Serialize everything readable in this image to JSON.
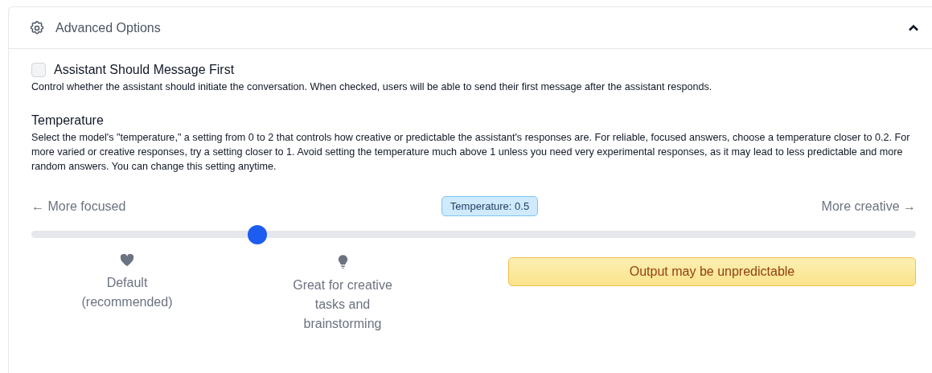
{
  "panel": {
    "title": "Advanced Options",
    "expanded": true
  },
  "assistant_first": {
    "label": "Assistant Should Message First",
    "checked": false,
    "description": "Control whether the assistant should initiate the conversation. When checked, users will be able to send their first message after the assistant responds."
  },
  "temperature": {
    "heading": "Temperature",
    "description": "Select the model's \"temperature,\" a setting from 0 to 2 that controls how creative or predictable the assistant's responses are. For reliable, focused answers, choose a temperature closer to 0.2. For more varied or creative responses, try a setting closer to 1. Avoid setting the temperature much above 1 unless you need very experimental responses, as it may lead to less predictable and more random answers. You can change this setting anytime.",
    "left_arrow": "←",
    "left_label": "More focused",
    "badge": "Temperature: 0.5",
    "right_label": "More creative",
    "right_arrow": "→",
    "level": 0.255
  },
  "markers": [
    {
      "kind": "heart",
      "text": "Default (recommended)"
    },
    {
      "kind": "bulb",
      "text": "Great for creative tasks and brainstorming"
    }
  ],
  "warning": "Output may be unpredictable"
}
